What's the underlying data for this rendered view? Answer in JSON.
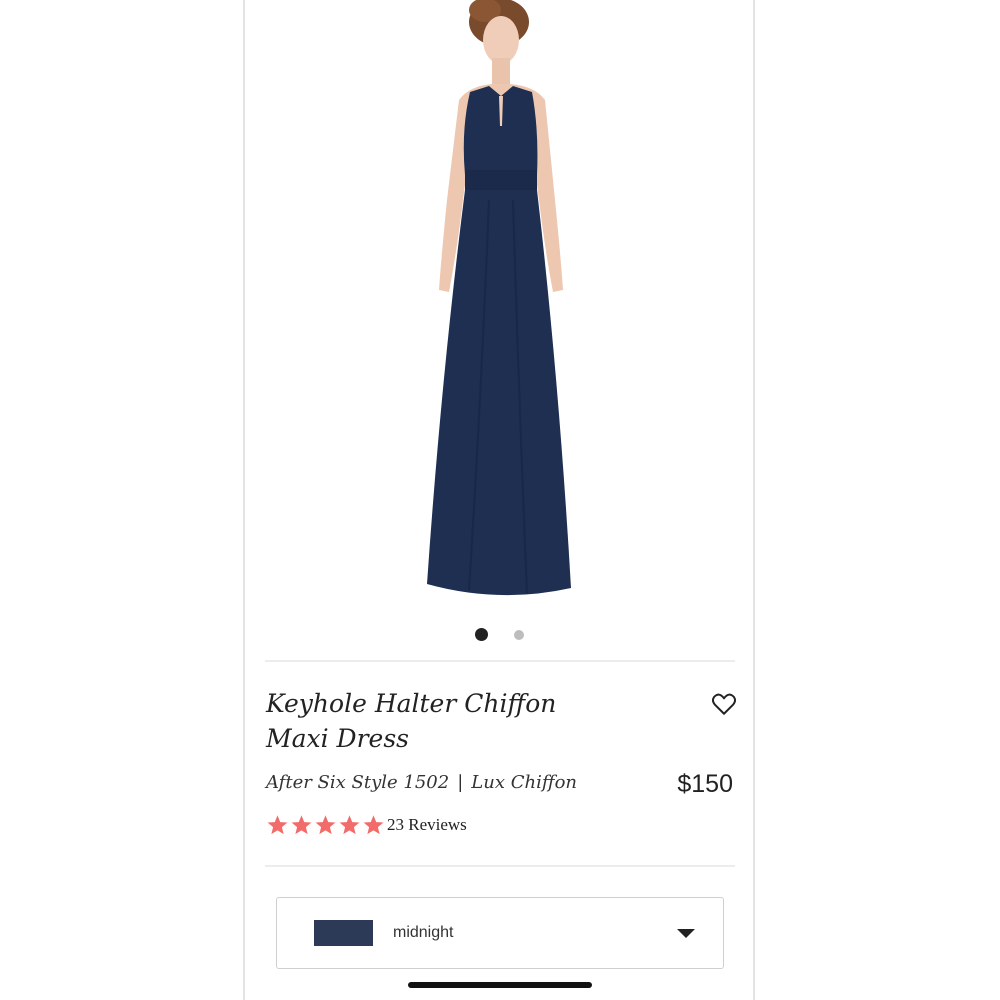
{
  "product": {
    "image_alt": "Model wearing navy keyhole halter chiffon maxi dress",
    "carousel": {
      "count": 2,
      "active_index": 0
    },
    "title": "Keyhole Halter Chiffon Maxi Dress",
    "style": "After Six Style 1502",
    "separator": "|",
    "fabric": "Lux Chiffon",
    "price": "$150",
    "rating": {
      "stars": 5,
      "max": 5,
      "reviews_text": "23 Reviews"
    },
    "favorite_icon": "heart-outline-icon"
  },
  "color_select": {
    "selected_label": "midnight",
    "swatch_color": "#2c3a57",
    "caret_icon": "caret-down-icon"
  },
  "colors": {
    "star": "#f26b6b",
    "dress": "#1e2f52",
    "text": "#222222"
  }
}
